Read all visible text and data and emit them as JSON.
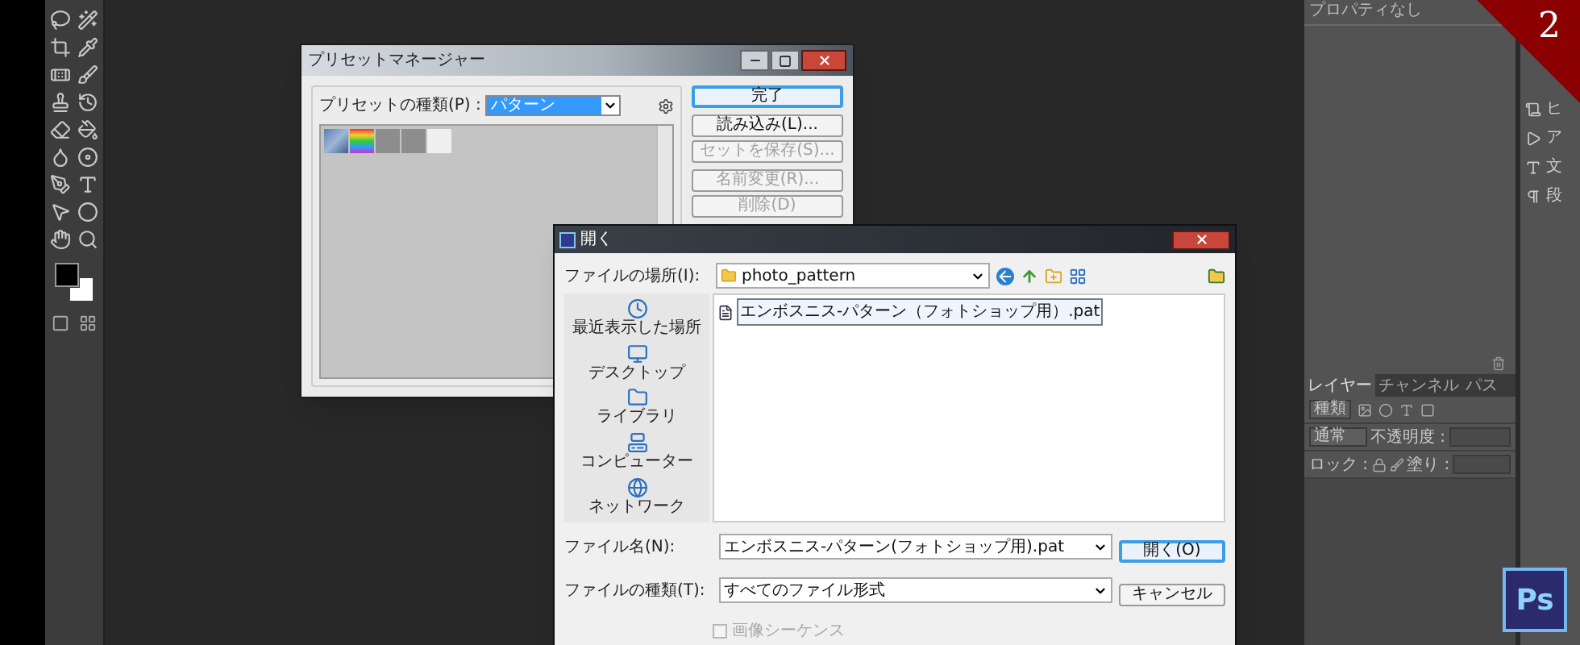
{
  "properties_panel": {
    "title": "プロパティなし"
  },
  "dock": {
    "items": [
      {
        "label": "ヒ",
        "kind": "history"
      },
      {
        "label": "ア",
        "kind": "actions"
      },
      {
        "label": "文",
        "kind": "character"
      },
      {
        "label": "段",
        "kind": "paragraph"
      }
    ]
  },
  "layers_panel": {
    "tabs": [
      {
        "label": "レイヤー",
        "selected": true
      },
      {
        "label": "チャンネル",
        "selected": false
      },
      {
        "label": "パス",
        "selected": false
      }
    ],
    "filter": "種類",
    "blend_mode": "通常",
    "opacity_label": "不透明度 :",
    "lock_label": "ロック :",
    "fill_label": "塗り :"
  },
  "preset_manager": {
    "title": "プリセットマネージャー",
    "preset_type_label": "プリセットの種類(P) :",
    "preset_type_value": "パターン",
    "button_groups": [
      {
        "buttons": [
          {
            "label": "完了",
            "disabled": false,
            "default": true
          }
        ]
      },
      {
        "buttons": [
          {
            "label": "読み込み(L)...",
            "disabled": false,
            "default": false
          },
          {
            "label": "セットを保存(S)...",
            "disabled": true,
            "default": false
          }
        ]
      },
      {
        "buttons": [
          {
            "label": "名前変更(R)...",
            "disabled": true,
            "default": false
          },
          {
            "label": "削除(D)",
            "disabled": true,
            "default": false
          }
        ]
      }
    ]
  },
  "open_dialog": {
    "title": "開く",
    "location_label": "ファイルの場所(I):",
    "location_value": "photo_pattern",
    "places": [
      {
        "label": "最近表示した場所",
        "kind": "recent"
      },
      {
        "label": "デスクトップ",
        "kind": "desktop"
      },
      {
        "label": "ライブラリ",
        "kind": "library"
      },
      {
        "label": "コンピューター",
        "kind": "computer"
      },
      {
        "label": "ネットワーク",
        "kind": "network"
      }
    ],
    "files": [
      {
        "name": "エンボスニス-パターン（フォトショップ用）.pat",
        "selected": true
      }
    ],
    "file_name_label": "ファイル名(N):",
    "file_name_value": "エンボスニス-パターン(フォトショップ用).pat",
    "file_type_label": "ファイルの種類(T):",
    "file_type_value": "すべてのファイル形式",
    "buttons": [
      {
        "label": "開く(O)",
        "default": true
      },
      {
        "label": "キャンセル",
        "default": false
      }
    ],
    "image_sequence": {
      "label": "画像シーケンス",
      "checked": false,
      "disabled": true
    }
  },
  "badge": {
    "number": "2"
  },
  "app_logo": {
    "text": "Ps"
  }
}
